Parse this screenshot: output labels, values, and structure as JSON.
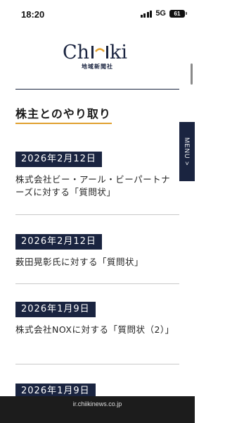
{
  "status_bar": {
    "time": "18:20",
    "network": "5G",
    "battery": "61"
  },
  "brand": {
    "logo_text": "Chiiki",
    "subtitle": "地域新聞社"
  },
  "section": {
    "title": "株主とのやり取り"
  },
  "menu": {
    "label": "MENU >"
  },
  "news": [
    {
      "date": "2026年2月12日",
      "title": "株式会社ビー・アール・ビーパートナーズに対する「質問状」"
    },
    {
      "date": "2026年2月12日",
      "title": "薮田晃彰氏に対する「質問状」"
    },
    {
      "date": "2026年1月9日",
      "title": "株式会社NOXに対する「質問状（2）」"
    },
    {
      "date": "2026年1月9日",
      "title": ""
    }
  ],
  "browser": {
    "url": "ir.chiikinews.co.jp"
  },
  "colors": {
    "navy": "#1a2440",
    "accent": "#e0a030"
  }
}
